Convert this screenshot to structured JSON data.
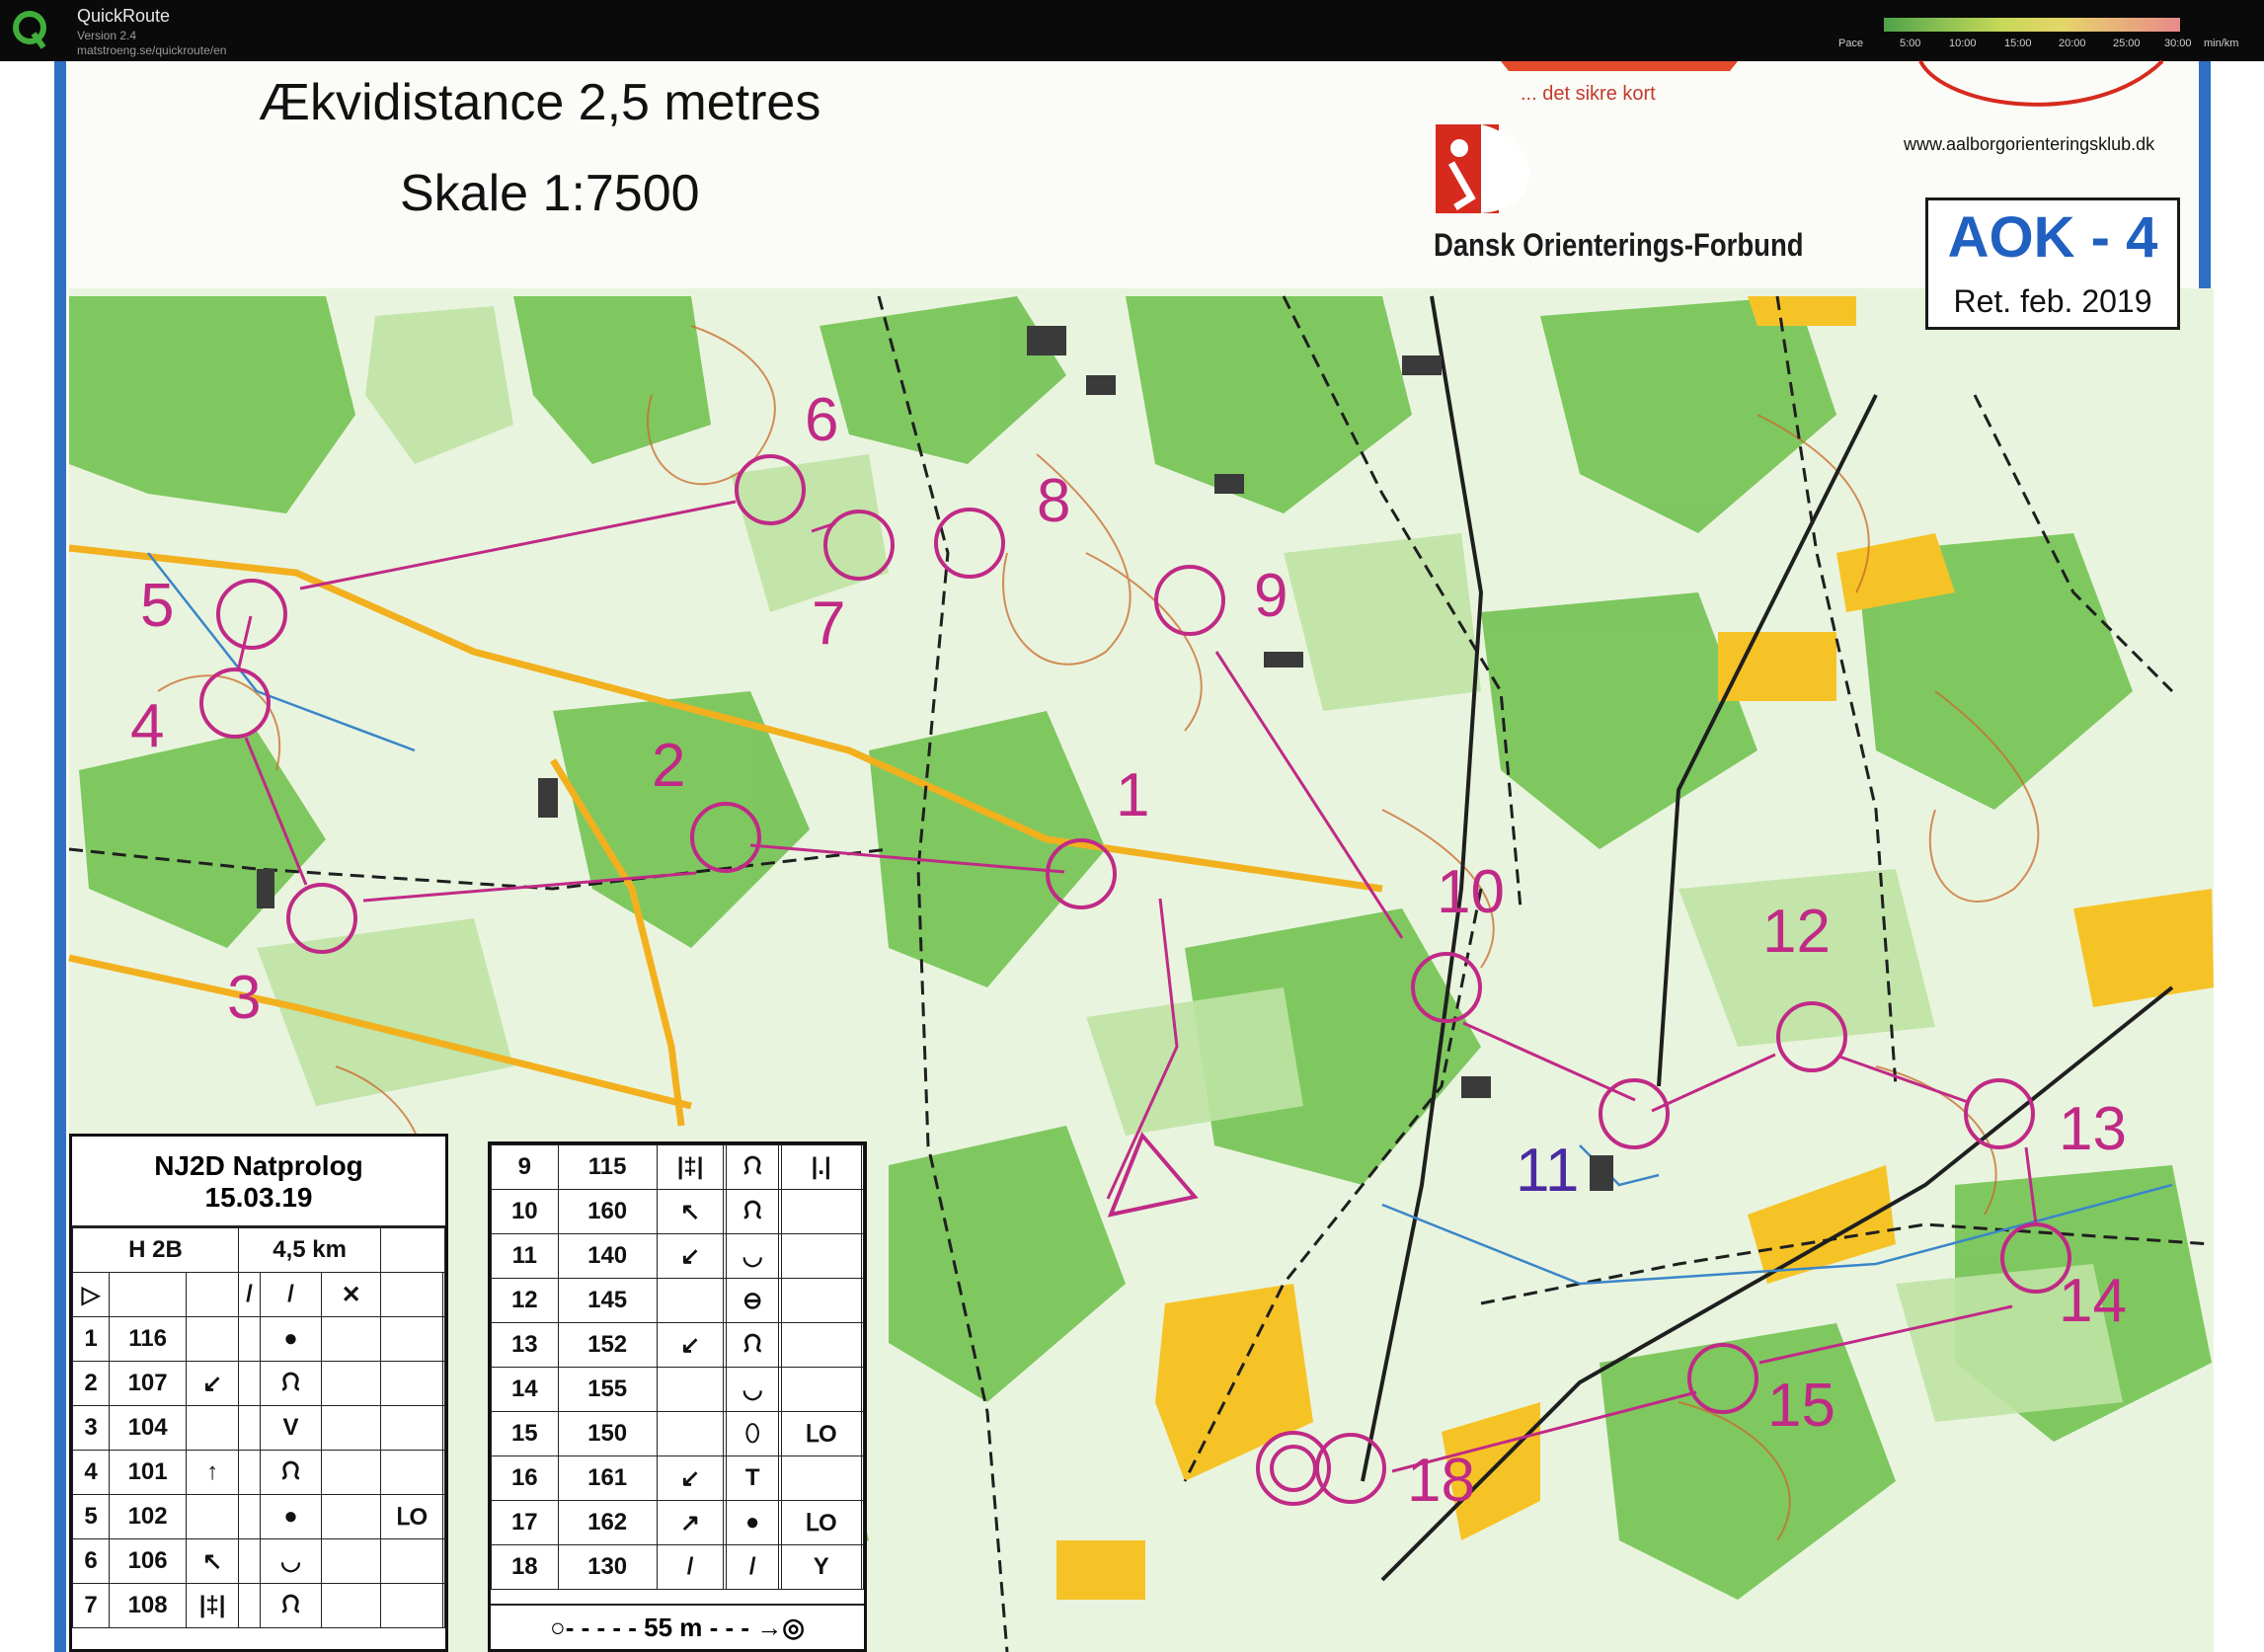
{
  "app": {
    "name": "QuickRoute",
    "version": "Version 2.4",
    "url": "matstroeng.se/quickroute/en",
    "pace_label": "Pace",
    "pace_ticks": [
      "5:00",
      "10:00",
      "15:00",
      "20:00",
      "25:00",
      "30:00"
    ],
    "pace_unit": "min/km"
  },
  "map_header": {
    "equidistance": "Ækvidistance  2,5 metres",
    "scale": "Skale  1:7500",
    "sponsor_tagline": "... det sikre kort",
    "federation": "Dansk Orienterings-Forbund",
    "club_url": "www.aalborgorienteringsklub.dk",
    "map_name": "AOK - 4",
    "revision": "Ret. feb. 2019"
  },
  "colors": {
    "course": "#c02a86",
    "forest_green": "#6cbf4a",
    "light_green": "#bfe3a4",
    "contour": "#c86a2a",
    "open_yellow": "#f6c327",
    "frame_blue": "#2f6fc4"
  },
  "course": {
    "controls": [
      "1",
      "2",
      "3",
      "4",
      "5",
      "6",
      "7",
      "8",
      "9",
      "10",
      "11",
      "12",
      "13",
      "14",
      "15",
      "18"
    ]
  },
  "description": {
    "event": "NJ2D Natprolog",
    "date": "15.03.19",
    "class": "H 2B",
    "length": "4,5 km",
    "start_symbol": "▷",
    "left_rows": [
      {
        "n": "1",
        "code": "116",
        "dir": "",
        "sym": "●",
        "extra": ""
      },
      {
        "n": "2",
        "code": "107",
        "dir": "↙",
        "sym": "ᙁ",
        "extra": ""
      },
      {
        "n": "3",
        "code": "104",
        "dir": "",
        "sym": "V",
        "extra": ""
      },
      {
        "n": "4",
        "code": "101",
        "dir": "↑",
        "sym": "ᙁ",
        "extra": ""
      },
      {
        "n": "5",
        "code": "102",
        "dir": "",
        "sym": "●",
        "extra": "ᒪO"
      },
      {
        "n": "6",
        "code": "106",
        "dir": "↖",
        "sym": "◡",
        "extra": ""
      },
      {
        "n": "7",
        "code": "108",
        "dir": "|‡|",
        "sym": "ᙁ",
        "extra": ""
      }
    ],
    "right_rows": [
      {
        "n": "9",
        "code": "115",
        "dir": "|‡|",
        "sym": "ᙁ",
        "extra": "|.|"
      },
      {
        "n": "10",
        "code": "160",
        "dir": "↖",
        "sym": "ᙁ",
        "extra": ""
      },
      {
        "n": "11",
        "code": "140",
        "dir": "↙",
        "sym": "◡",
        "extra": ""
      },
      {
        "n": "12",
        "code": "145",
        "dir": "",
        "sym": "⊖",
        "extra": ""
      },
      {
        "n": "13",
        "code": "152",
        "dir": "↙",
        "sym": "ᙁ",
        "extra": ""
      },
      {
        "n": "14",
        "code": "155",
        "dir": "",
        "sym": "◡",
        "extra": ""
      },
      {
        "n": "15",
        "code": "150",
        "dir": "",
        "sym": "⬯",
        "extra": "ᒪO"
      },
      {
        "n": "16",
        "code": "161",
        "dir": "↙",
        "sym": "T",
        "extra": ""
      },
      {
        "n": "17",
        "code": "162",
        "dir": "↗",
        "sym": "●",
        "extra": "ᒪO"
      },
      {
        "n": "18",
        "code": "130",
        "dir": "/",
        "sym": "/",
        "extra": "Y"
      }
    ],
    "finish": "○- - - - -  55 m  - - - →◎"
  }
}
